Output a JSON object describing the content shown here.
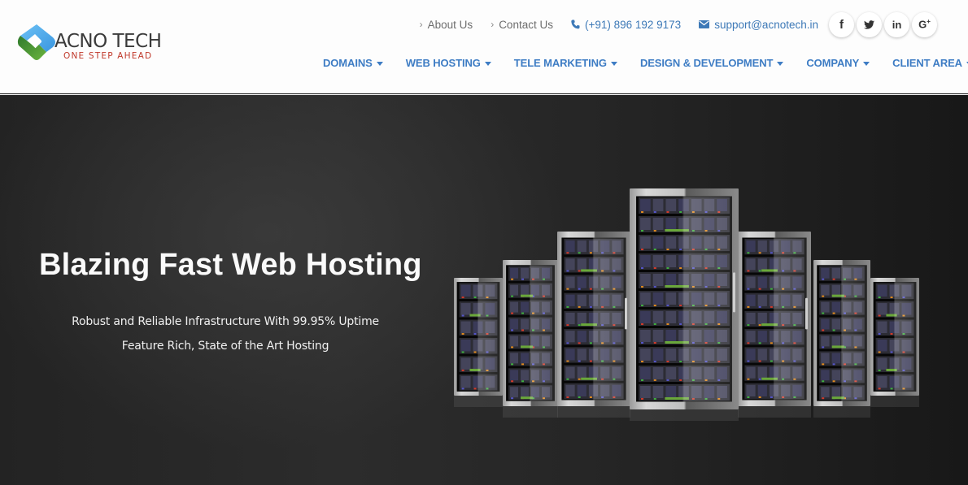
{
  "brand": {
    "name": "ACNO TECH",
    "tagline": "ONE STEP AHEAD",
    "colors": {
      "blue": "#4aa8e8",
      "green": "#3f9a3a",
      "tagline": "#c0392b"
    }
  },
  "topbar": {
    "links": [
      {
        "label": "About Us",
        "icon": "chevron-right-icon"
      },
      {
        "label": "Contact Us",
        "icon": "chevron-right-icon"
      }
    ],
    "phone": {
      "label": "(+91) 896 192 9173",
      "icon": "phone-icon"
    },
    "email": {
      "label": "support@acnotech.in",
      "icon": "envelope-icon"
    },
    "social": [
      {
        "name": "facebook",
        "glyph": "f",
        "icon": "facebook-icon"
      },
      {
        "name": "twitter",
        "glyph": "🐦",
        "icon": "twitter-icon"
      },
      {
        "name": "linkedin",
        "glyph": "in",
        "icon": "linkedin-icon"
      },
      {
        "name": "google-plus",
        "glyph": "G+",
        "icon": "google-plus-icon"
      }
    ]
  },
  "nav": {
    "accent": "#3d7cc4",
    "items": [
      {
        "label": "DOMAINS"
      },
      {
        "label": "WEB HOSTING"
      },
      {
        "label": "TELE MARKETING"
      },
      {
        "label": "DESIGN & DEVELOPMENT"
      },
      {
        "label": "COMPANY"
      },
      {
        "label": "CLIENT AREA"
      }
    ]
  },
  "hero": {
    "title": "Blazing Fast Web Hosting",
    "subtitle_line1": "Robust and Reliable Infrastructure With 99.95% Uptime",
    "subtitle_line2": "Feature Rich, State of the Art Hosting",
    "image": "server-racks-illustration"
  }
}
